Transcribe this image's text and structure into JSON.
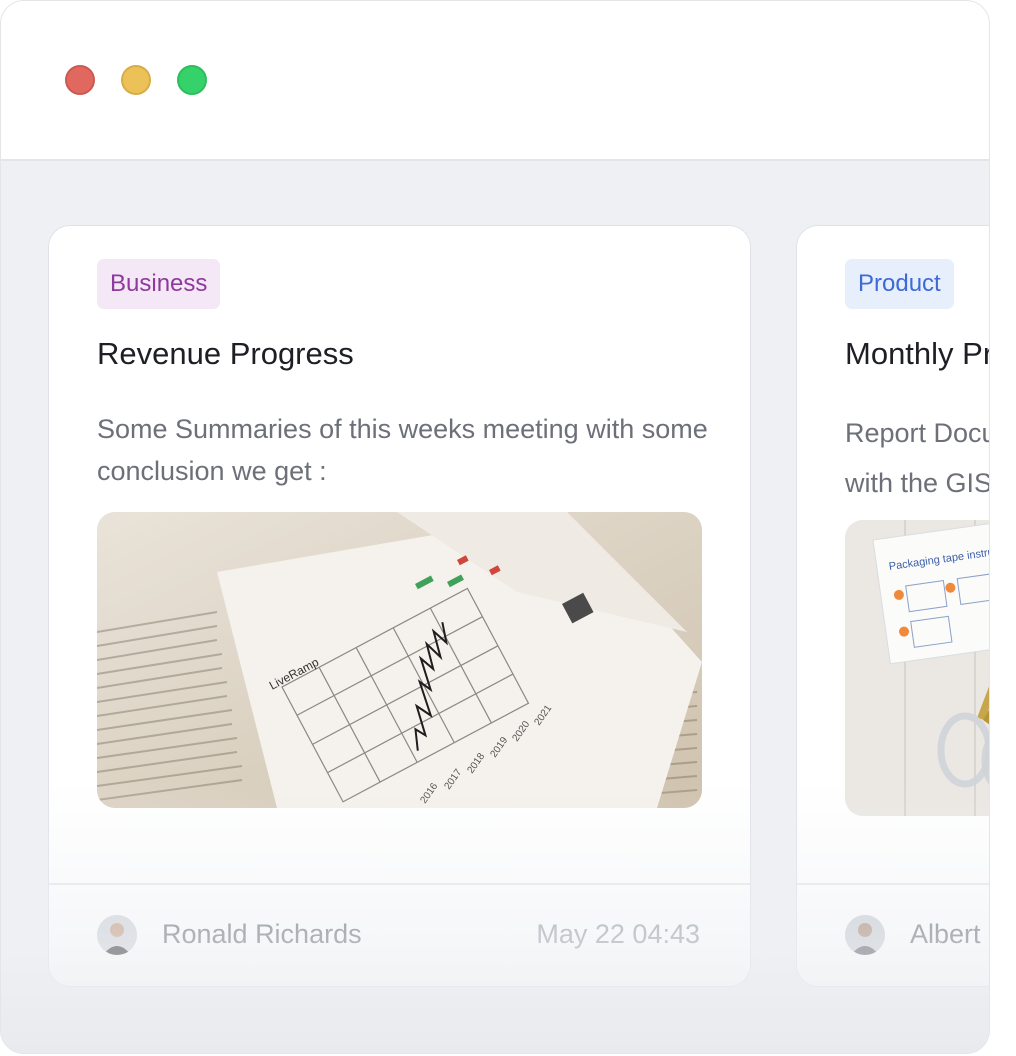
{
  "window": {
    "controls": [
      "close",
      "minimize",
      "maximize"
    ]
  },
  "cards": [
    {
      "tag": "Business",
      "title": "Revenue Progress",
      "description": "Some Summaries of this weeks meeting with some conclusion we get :",
      "image_subject": "financial newspaper with stock chart",
      "image_texts": [
        "LiveRamp",
        "2016",
        "2017",
        "2018",
        "2019",
        "2020",
        "2021"
      ],
      "author": "Ronald Richards",
      "timestamp": "May 22 04:43"
    },
    {
      "tag": "Product",
      "title": "Monthly Pro",
      "description_line1": "Report Docur",
      "description_line2": "with the GISE",
      "image_subject": "packaging tape instructions with scissors",
      "image_texts": [
        "Packaging tape instructions"
      ],
      "author": "Albert F",
      "timestamp": ""
    }
  ],
  "colors": {
    "business_tag_bg": "#f4e7f6",
    "business_tag_text": "#8d3a9c",
    "product_tag_bg": "#e7effd",
    "product_tag_text": "#3d6ad6",
    "close": "#e0685f",
    "minimize": "#ebc158",
    "maximize": "#35d26b"
  }
}
